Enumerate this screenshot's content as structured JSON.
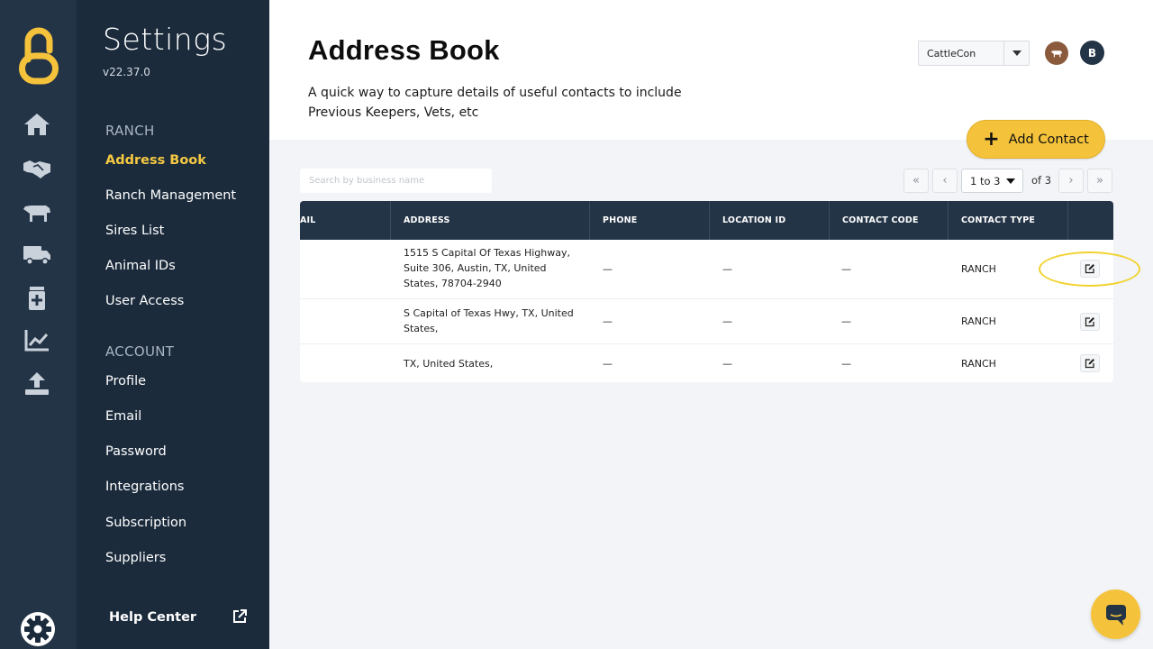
{
  "rail": {
    "icons": [
      "home-icon",
      "handshake-icon",
      "cow-icon",
      "truck-icon",
      "medicine-icon",
      "chart-icon",
      "upload-icon",
      "gear-icon"
    ]
  },
  "menu": {
    "title": "Settings",
    "version": "v22.37.0",
    "sections": [
      {
        "label": "RANCH",
        "items": [
          "Address Book",
          "Ranch Management",
          "Sires List",
          "Animal IDs",
          "User Access"
        ]
      },
      {
        "label": "ACCOUNT",
        "items": [
          "Profile",
          "Email",
          "Password",
          "Integrations",
          "Subscription",
          "Suppliers"
        ]
      }
    ],
    "active_item": "Address Book",
    "help": "Help Center"
  },
  "header": {
    "title": "Address Book",
    "description": "A quick way to capture details of useful contacts to include Previous Keepers, Vets, etc",
    "ranch_select": "CattleCon",
    "user_initial": "B",
    "add_button": "Add Contact"
  },
  "toolbar": {
    "search_placeholder": "Search by business name",
    "pagination": {
      "first": "«",
      "prev": "‹",
      "range": "1 to 3",
      "of": "of 3",
      "next": "›",
      "last": "»"
    }
  },
  "table": {
    "columns": [
      "AIL",
      "ADDRESS",
      "PHONE",
      "LOCATION ID",
      "CONTACT CODE",
      "CONTACT TYPE"
    ],
    "rows": [
      {
        "address": "1515 S Capital Of Texas Highway, Suite 306, Austin, TX, United States, 78704-2940",
        "phone": "—",
        "location_id": "—",
        "contact_code": "—",
        "contact_type": "RANCH"
      },
      {
        "address": "S Capital of Texas Hwy, TX, United States,",
        "phone": "—",
        "location_id": "—",
        "contact_code": "—",
        "contact_type": "RANCH"
      },
      {
        "address": "TX, United States,",
        "phone": "—",
        "location_id": "—",
        "contact_code": "—",
        "contact_type": "RANCH"
      }
    ]
  },
  "colors": {
    "accent": "#f5c33b",
    "active_menu": "#f5c842",
    "rail_bg": "#243447",
    "menu_bg": "#1b2b3c",
    "table_header": "#243447"
  }
}
